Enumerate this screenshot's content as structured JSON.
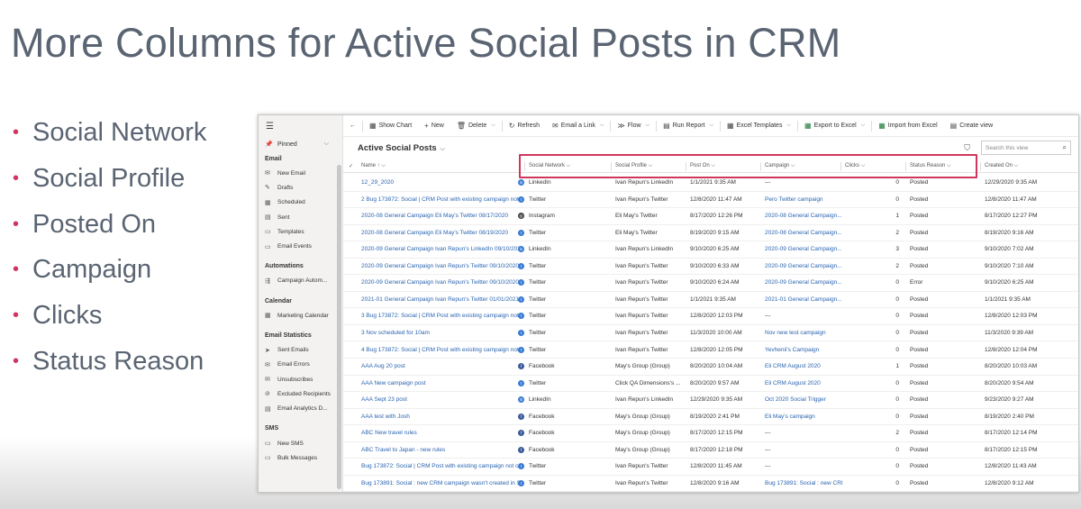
{
  "slide": {
    "title": "More Columns for Active Social Posts in CRM",
    "bullets": [
      "Social Network",
      "Social Profile",
      "Posted On",
      "Campaign",
      "Clicks",
      "Status Reason"
    ]
  },
  "colors": {
    "accent": "#d1355e",
    "link": "#2a64b0",
    "title": "#5a6472"
  },
  "cmdbar": {
    "back": "←",
    "items": [
      "Show Chart",
      "New",
      "Delete",
      "Refresh",
      "Email a Link",
      "Flow",
      "Run Report",
      "Excel Templates",
      "Export to Excel",
      "Import from Excel",
      "Create view"
    ]
  },
  "sidebar": {
    "menu": "☰",
    "pinned": "Pinned",
    "sections": [
      {
        "title": "Email",
        "items": [
          "New Email",
          "Drafts",
          "Scheduled",
          "Sent",
          "Templates",
          "Email Events"
        ]
      },
      {
        "title": "Automations",
        "items": [
          "Campaign Autom..."
        ]
      },
      {
        "title": "Calendar",
        "items": [
          "Marketing Calendar"
        ]
      },
      {
        "title": "Email Statistics",
        "items": [
          "Sent Emails",
          "Email Errors",
          "Unsubscribes",
          "Excluded Recipients",
          "Email Analytics D..."
        ]
      },
      {
        "title": "SMS",
        "items": [
          "New SMS",
          "Bulk Messages"
        ]
      }
    ]
  },
  "view": {
    "title": "Active Social Posts",
    "search_placeholder": "Search this view"
  },
  "grid": {
    "columns": [
      "Name ↑",
      "Social Network",
      "Social Profile",
      "Post On",
      "Campaign",
      "Clicks",
      "Status Reason",
      "Created On"
    ],
    "rows": [
      [
        "12_29_2020",
        "LinkedIn",
        "Ivan Repun's LinkedIn",
        "1/1/2021 9:35 AM",
        "---",
        "0",
        "Posted",
        "12/29/2020 9:35 AM"
      ],
      [
        "2 Bug 173872: Social | CRM Post with existing campaign not c",
        "Twitter",
        "Ivan Repun's Twitter",
        "12/8/2020 11:47 AM",
        "Pero Twitter campaign",
        "0",
        "Posted",
        "12/8/2020 11:47 AM"
      ],
      [
        "2020-08 General Campaign Eli May's Twitter 08/17/2020",
        "Instagram",
        "Eli May's Twitter",
        "8/17/2020 12:26 PM",
        "2020-08 General Campaign...",
        "1",
        "Posted",
        "8/17/2020 12:27 PM"
      ],
      [
        "2020-08 General Campaign Eli May's Twitter 08/19/2020",
        "Twitter",
        "Eli May's Twitter",
        "8/19/2020 9:15 AM",
        "2020-08 General Campaign...",
        "2",
        "Posted",
        "8/19/2020 9:16 AM"
      ],
      [
        "2020-09 General Campaign Ivan Repun's LinkedIn 09/10/2020",
        "LinkedIn",
        "Ivan Repun's LinkedIn",
        "9/10/2020 6:25 AM",
        "2020-09 General Campaign...",
        "3",
        "Posted",
        "9/10/2020 7:02 AM"
      ],
      [
        "2020-09 General Campaign Ivan Repun's Twitter 09/10/2020",
        "Twitter",
        "Ivan Repun's Twitter",
        "9/10/2020 6:33 AM",
        "2020-09 General Campaign...",
        "2",
        "Posted",
        "9/10/2020 7:10 AM"
      ],
      [
        "2020-09 General Campaign Ivan Repun's Twitter 09/10/2020",
        "Twitter",
        "Ivan Repun's Twitter",
        "9/10/2020 6:24 AM",
        "2020-09 General Campaign...",
        "0",
        "Error",
        "9/10/2020 6:25 AM"
      ],
      [
        "2021-01 General Campaign Ivan Repun's Twitter 01/01/2021",
        "Twitter",
        "Ivan Repun's Twitter",
        "1/1/2021 9:35 AM",
        "2021-01 General Campaign...",
        "0",
        "Posted",
        "1/1/2021 9:35 AM"
      ],
      [
        "3 Bug 173872: Social | CRM Post with existing campaign not c",
        "Twitter",
        "Ivan Repun's Twitter",
        "12/8/2020 12:03 PM",
        "---",
        "0",
        "Posted",
        "12/8/2020 12:03 PM"
      ],
      [
        "3 Nov scheduled for 10am",
        "Twitter",
        "Ivan Repun's Twitter",
        "11/3/2020 10:00 AM",
        "Nov new test campaign",
        "0",
        "Posted",
        "11/3/2020 9:39 AM"
      ],
      [
        "4 Bug 173872: Social | CRM Post with existing campaign not c",
        "Twitter",
        "Ivan Repun's Twitter",
        "12/8/2020 12:05 PM",
        "Yevhenii's Campaign",
        "0",
        "Posted",
        "12/8/2020 12:04 PM"
      ],
      [
        "AAA Aug 20 post",
        "Facebook",
        "May's Group (Group)",
        "8/20/2020 10:04 AM",
        "Eli CRM August 2020",
        "1",
        "Posted",
        "8/20/2020 10:03 AM"
      ],
      [
        "AAA New campaign post",
        "Twitter",
        "Click QA Dimensions's ...",
        "8/20/2020 9:57 AM",
        "Eli CRM August 2020",
        "0",
        "Posted",
        "8/20/2020 9:54 AM"
      ],
      [
        "AAA Sept 23 post",
        "LinkedIn",
        "Ivan Repun's LinkedIn",
        "12/29/2020 9:35 AM",
        "Oct 2020 Social Trigger",
        "0",
        "Posted",
        "9/23/2020 9:27 AM"
      ],
      [
        "AAA test with Josh",
        "Facebook",
        "May's Group (Group)",
        "8/19/2020 2:41 PM",
        "Eli May's campaign",
        "0",
        "Posted",
        "8/19/2020 2:40 PM"
      ],
      [
        "ABC New travel rules",
        "Facebook",
        "May's Group (Group)",
        "8/17/2020 12:15 PM",
        "---",
        "2",
        "Posted",
        "8/17/2020 12:14 PM"
      ],
      [
        "ABC Travel to Japan - new rules",
        "Facebook",
        "May's Group (Group)",
        "8/17/2020 12:18 PM",
        "---",
        "0",
        "Posted",
        "8/17/2020 12:15 PM"
      ],
      [
        "Bug 173872: Social | CRM Post with existing campaign not cr",
        "Twitter",
        "Ivan Repun's Twitter",
        "12/8/2020 11:45 AM",
        "---",
        "0",
        "Posted",
        "12/8/2020 11:43 AM"
      ],
      [
        "Bug 173891: Social : new CRM campaign wasn't created in Sc",
        "Twitter",
        "Ivan Repun's Twitter",
        "12/8/2020 9:16 AM",
        "Bug 173891: Social : new CRI",
        "0",
        "Posted",
        "12/8/2020 9:12 AM"
      ]
    ]
  }
}
